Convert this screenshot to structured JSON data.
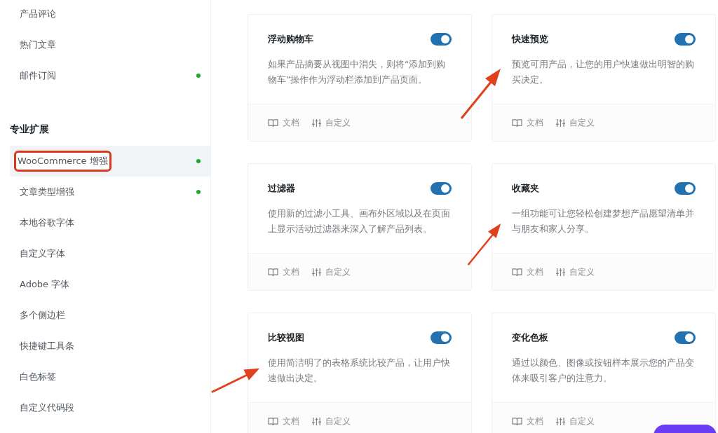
{
  "sidebar": {
    "items": [
      {
        "label": "产品评论",
        "selected": false,
        "active": false,
        "highlighted": false
      },
      {
        "label": "热门文章",
        "selected": false,
        "active": false,
        "highlighted": false
      },
      {
        "label": "邮件订阅",
        "selected": false,
        "active": true,
        "highlighted": false
      }
    ],
    "section_title": "专业扩展",
    "section_items": [
      {
        "label": "WooCommerce 增强",
        "selected": true,
        "active": true,
        "highlighted": true
      },
      {
        "label": "文章类型增强",
        "selected": false,
        "active": true,
        "highlighted": false
      },
      {
        "label": "本地谷歌字体",
        "selected": false,
        "active": false,
        "highlighted": false
      },
      {
        "label": "自定义字体",
        "selected": false,
        "active": false,
        "highlighted": false
      },
      {
        "label": "Adobe 字体",
        "selected": false,
        "active": false,
        "highlighted": false
      },
      {
        "label": "多个侧边栏",
        "selected": false,
        "active": false,
        "highlighted": false
      },
      {
        "label": "快捷键工具条",
        "selected": false,
        "active": false,
        "highlighted": false
      },
      {
        "label": "白色标签",
        "selected": false,
        "active": false,
        "highlighted": false
      },
      {
        "label": "自定义代码段",
        "selected": false,
        "active": false,
        "highlighted": false
      }
    ]
  },
  "modules": [
    {
      "title": "浮动购物车",
      "on": true,
      "description": "如果产品摘要从视图中消失，则将“添加到购物车”操作作为浮动栏添加到产品页面。",
      "docs": "文档",
      "customize": "自定义"
    },
    {
      "title": "快速预览",
      "on": true,
      "description": "预览可用产品，让您的用户快速做出明智的购买决定。",
      "docs": "文档",
      "customize": "自定义"
    },
    {
      "title": "过滤器",
      "on": true,
      "description": "使用新的过滤小工具、画布外区域以及在页面上显示活动过滤器来深入了解产品列表。",
      "docs": "文档",
      "customize": "自定义"
    },
    {
      "title": "收藏夹",
      "on": true,
      "description": "一组功能可让您轻松创建梦想产品愿望清单并与朋友和家人分享。",
      "docs": "文档",
      "customize": "自定义"
    },
    {
      "title": "比较视图",
      "on": true,
      "description": "使用简洁明了的表格系统比较产品，让用户快速做出决定。",
      "docs": "文档",
      "customize": "自定义"
    },
    {
      "title": "变化色板",
      "on": true,
      "description": "通过以颜色、图像或按钮样本展示您的产品变体来吸引客户的注意力。",
      "docs": "文档",
      "customize": "自定义"
    }
  ]
}
